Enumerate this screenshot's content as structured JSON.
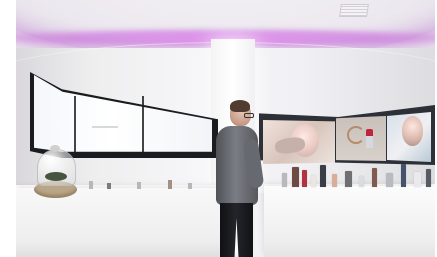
{
  "scene": {
    "description_labels": [],
    "colors": {
      "ceiling_glow": "#d98cf0",
      "wall": "#f1f0f3",
      "screen_frame": "#1b1c20",
      "person_sweater": "#6f7279",
      "person_pants": "#18191d",
      "counter": "#f7f7f7"
    }
  }
}
